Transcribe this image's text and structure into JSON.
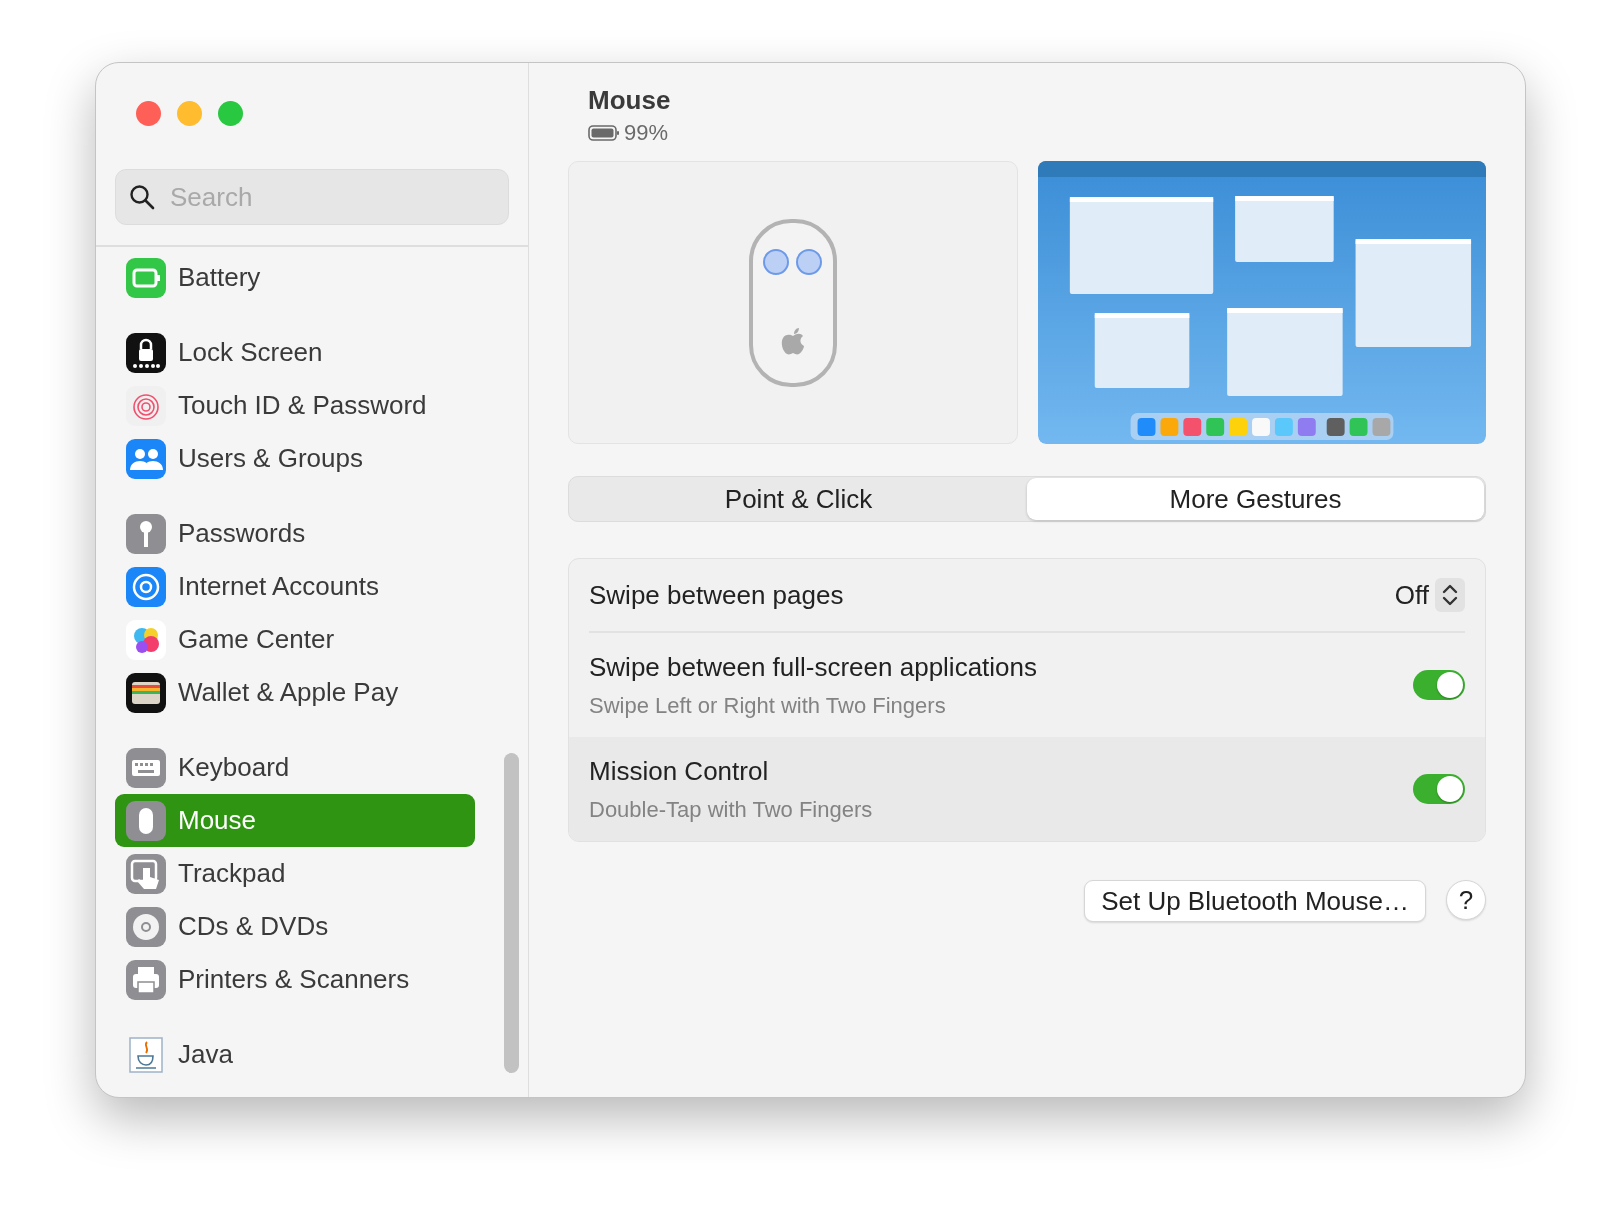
{
  "search": {
    "placeholder": "Search"
  },
  "sidebar": {
    "groups": [
      {
        "items": [
          {
            "label": "Battery",
            "selected": false
          }
        ]
      },
      {
        "items": [
          {
            "label": "Lock Screen",
            "selected": false
          },
          {
            "label": "Touch ID & Password",
            "selected": false
          },
          {
            "label": "Users & Groups",
            "selected": false
          }
        ]
      },
      {
        "items": [
          {
            "label": "Passwords",
            "selected": false
          },
          {
            "label": "Internet Accounts",
            "selected": false
          },
          {
            "label": "Game Center",
            "selected": false
          },
          {
            "label": "Wallet & Apple Pay",
            "selected": false
          }
        ]
      },
      {
        "items": [
          {
            "label": "Keyboard",
            "selected": false
          },
          {
            "label": "Mouse",
            "selected": true
          },
          {
            "label": "Trackpad",
            "selected": false
          },
          {
            "label": "CDs & DVDs",
            "selected": false
          },
          {
            "label": "Printers & Scanners",
            "selected": false
          }
        ]
      },
      {
        "items": [
          {
            "label": "Java",
            "selected": false
          }
        ]
      }
    ]
  },
  "header": {
    "title": "Mouse",
    "battery": "99%"
  },
  "segments": [
    {
      "label": "Point & Click",
      "selected": false
    },
    {
      "label": "More Gestures",
      "selected": true
    }
  ],
  "settings": [
    {
      "kind": "popup",
      "label": "Swipe between pages",
      "value": "Off",
      "highlighted": false
    },
    {
      "kind": "toggle",
      "label": "Swipe between full-screen applications",
      "detail": "Swipe Left or Right with Two Fingers",
      "on": true,
      "highlighted": false
    },
    {
      "kind": "toggle",
      "label": "Mission Control",
      "detail": "Double-Tap with Two Fingers",
      "on": true,
      "highlighted": true
    }
  ],
  "buttons": [
    {
      "label": "Set Up Bluetooth Mouse…"
    }
  ],
  "help": "?"
}
